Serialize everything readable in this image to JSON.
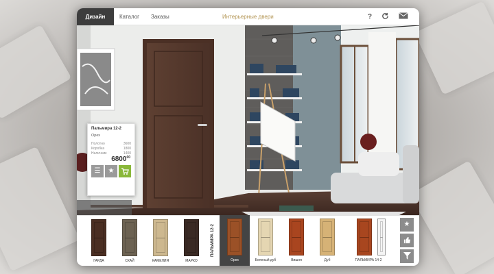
{
  "topbar": {
    "tabs": [
      {
        "label": "Дизайн",
        "active": true
      },
      {
        "label": "Каталог",
        "active": false
      },
      {
        "label": "Заказы",
        "active": false
      }
    ],
    "title": "Интерьерные двери",
    "icons": [
      "help-icon",
      "refresh-icon",
      "mail-icon"
    ],
    "help_glyph": "?"
  },
  "popup": {
    "name": "Пальмира 12-2",
    "color": "Орех",
    "specs": [
      {
        "label": "Полотно",
        "value": "3600"
      },
      {
        "label": "Коробка",
        "value": "1800"
      },
      {
        "label": "Наличник",
        "value": "1400"
      }
    ],
    "price": "6800",
    "price_cents": "00",
    "buttons": [
      "list-icon",
      "star-icon",
      "cart-icon"
    ],
    "accent": "#8ab83a"
  },
  "catalog": {
    "group_label": "ПАЛЬМИРА 12-2",
    "doors": [
      {
        "label": "ГАРДА",
        "color": "#4a2e22"
      },
      {
        "label": "СКАЙ",
        "color": "#6c6252"
      },
      {
        "label": "КАМЕЛИЯ",
        "color": "#cdb88f"
      },
      {
        "label": "МАРКО",
        "color": "#3a2a24"
      },
      {
        "label": "Орех",
        "color": "#9b5127",
        "selected": true
      },
      {
        "label": "Беленый дуб",
        "color": "#e5d6b2"
      },
      {
        "label": "Вишня",
        "color": "#a9451f"
      },
      {
        "label": "Дуб",
        "color": "#d6b276"
      },
      {
        "label": "ПАЛЬМИРА 14-2",
        "color": "#a8461f"
      }
    ],
    "side_buttons": [
      "star-icon",
      "thumbs-up-icon",
      "filter-icon"
    ]
  }
}
